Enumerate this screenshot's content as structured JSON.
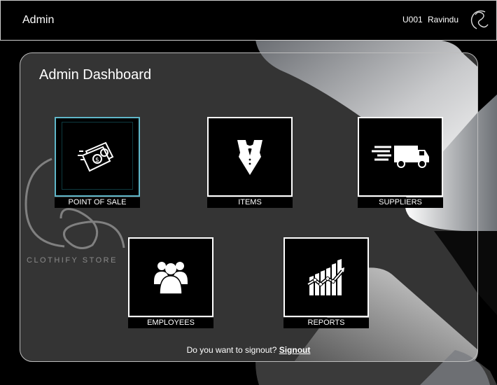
{
  "header": {
    "title": "Admin",
    "user_id": "U001",
    "user_name": "Ravindu"
  },
  "dashboard": {
    "title": "Admin Dashboard"
  },
  "tiles": [
    {
      "label": "POINT OF SALE",
      "icon": "money-icon"
    },
    {
      "label": "ITEMS",
      "icon": "tuxedo-icon"
    },
    {
      "label": "SUPPLIERS",
      "icon": "delivery-truck-icon"
    },
    {
      "label": "EMPLOYEES",
      "icon": "people-group-icon"
    },
    {
      "label": "REPORTS",
      "icon": "growth-chart-icon"
    }
  ],
  "watermark": {
    "text": "CLOTHIFY STORE"
  },
  "footer": {
    "prompt": "Do you want to signout?",
    "link": "Signout"
  },
  "colors": {
    "background": "#000000",
    "panel": "#333333",
    "active_border": "#5fb7c9"
  }
}
